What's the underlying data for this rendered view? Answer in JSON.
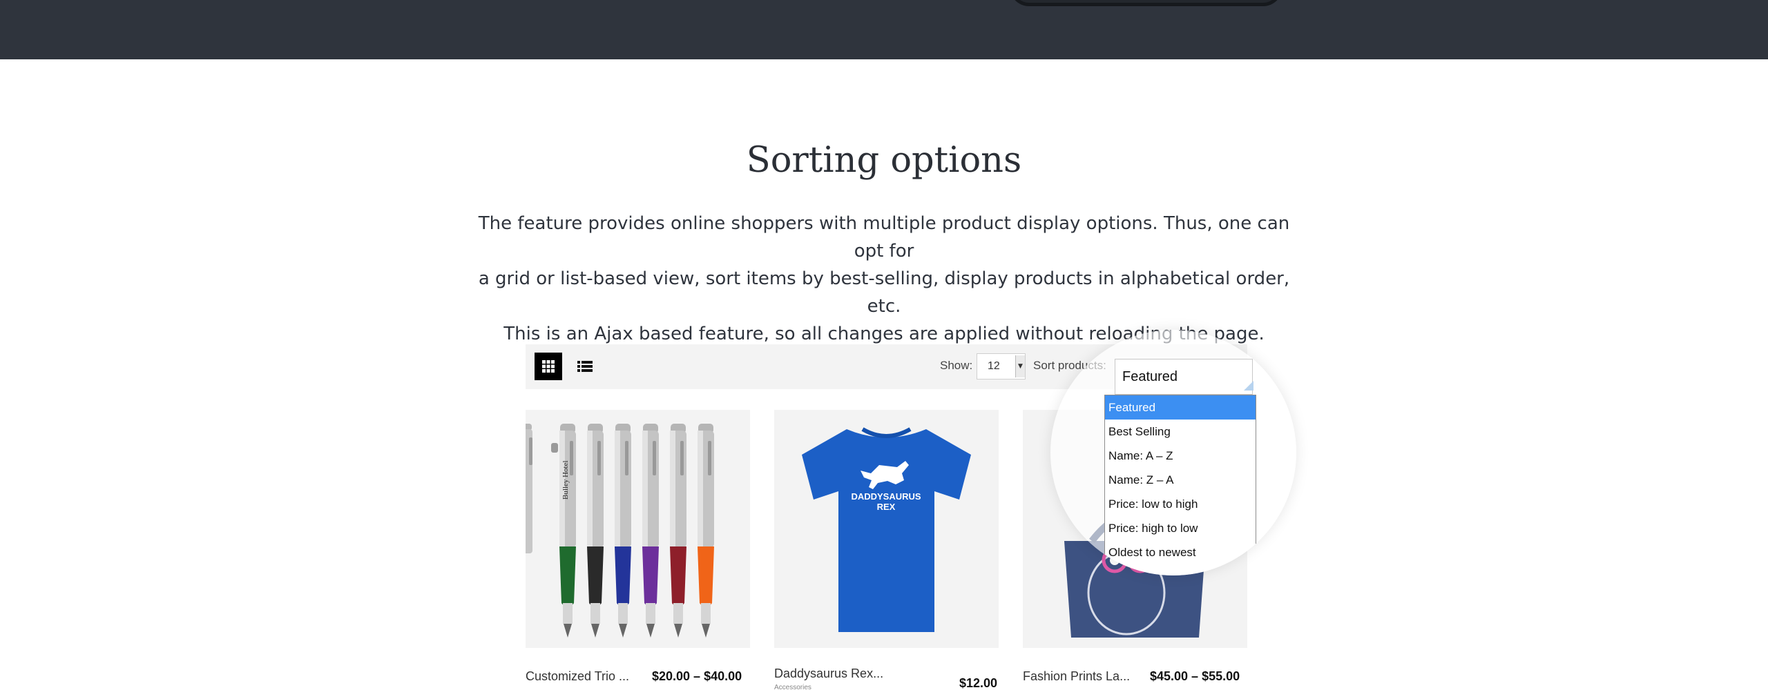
{
  "section": {
    "title": "Sorting options",
    "description_lines": [
      "The feature provides online shoppers with multiple product display options. Thus, one can opt for",
      "a grid or list-based view, sort items by best-selling, display products in alphabetical order, etc.",
      "This is an Ajax based feature, so all changes are applied without reloading the page."
    ]
  },
  "toolbar": {
    "grid_icon": "grid-view-icon",
    "list_icon": "list-view-icon",
    "show_label": "Show:",
    "show_value": "12",
    "sort_label": "Sort products:",
    "sort_value": "Featured",
    "sort_options": [
      "Featured",
      "Best Selling",
      "Name: A – Z",
      "Name: Z – A",
      "Price: low to high",
      "Price: high to low",
      "Oldest to newest"
    ],
    "selected_sort_index": 0
  },
  "products": [
    {
      "name": "Customized Trio ...",
      "price": "$20.00 – $40.00",
      "subtitle": ""
    },
    {
      "name": "Daddysaurus Rex...",
      "price": "$12.00",
      "subtitle": "Accessories"
    },
    {
      "name": "Fashion Prints La...",
      "price": "$45.00 – $55.00",
      "subtitle": ""
    }
  ],
  "product_images": {
    "pens_brand_text": "Bulley Hotel",
    "tshirt_text": [
      "DADDYSAURUS",
      "REX"
    ]
  },
  "colors": {
    "dark_header": "#2f343d",
    "toolbar_bg": "#f3f3f3",
    "card_bg": "#f3f3f3",
    "dropdown_highlight": "#3c8ff2",
    "tshirt_blue": "#1c5fc6"
  }
}
